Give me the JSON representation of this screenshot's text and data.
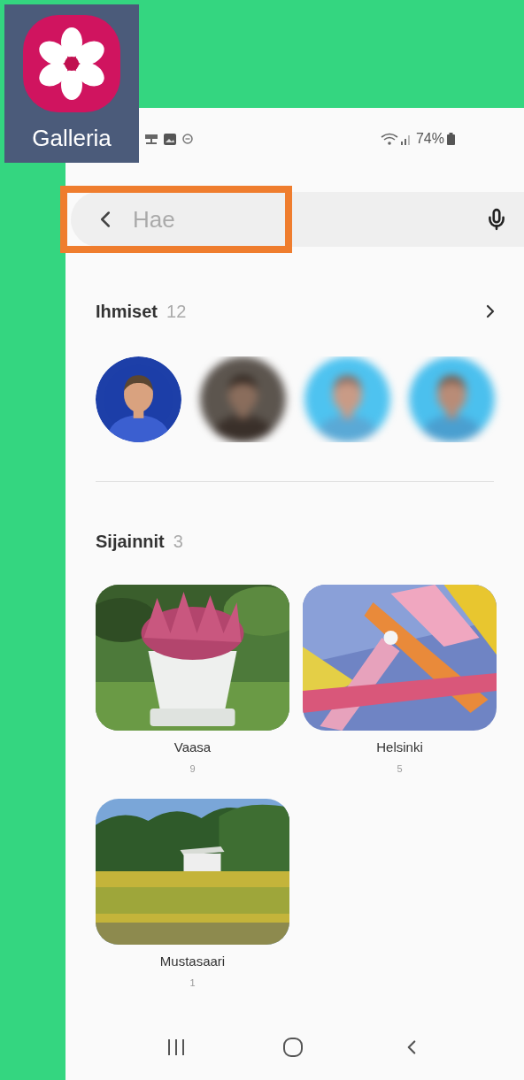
{
  "app_icon": {
    "label": "Galleria"
  },
  "status_bar": {
    "battery": "74%"
  },
  "search": {
    "placeholder": "Hae",
    "highlighted": true
  },
  "people": {
    "title": "Ihmiset",
    "count": "12",
    "avatars": [
      {
        "blurred": false
      },
      {
        "blurred": true
      },
      {
        "blurred": true
      },
      {
        "blurred": true
      }
    ]
  },
  "locations": {
    "title": "Sijainnit",
    "count": "3",
    "items": [
      {
        "name": "Vaasa",
        "count": "9"
      },
      {
        "name": "Helsinki",
        "count": "5"
      },
      {
        "name": "Mustasaari",
        "count": "1"
      }
    ]
  }
}
